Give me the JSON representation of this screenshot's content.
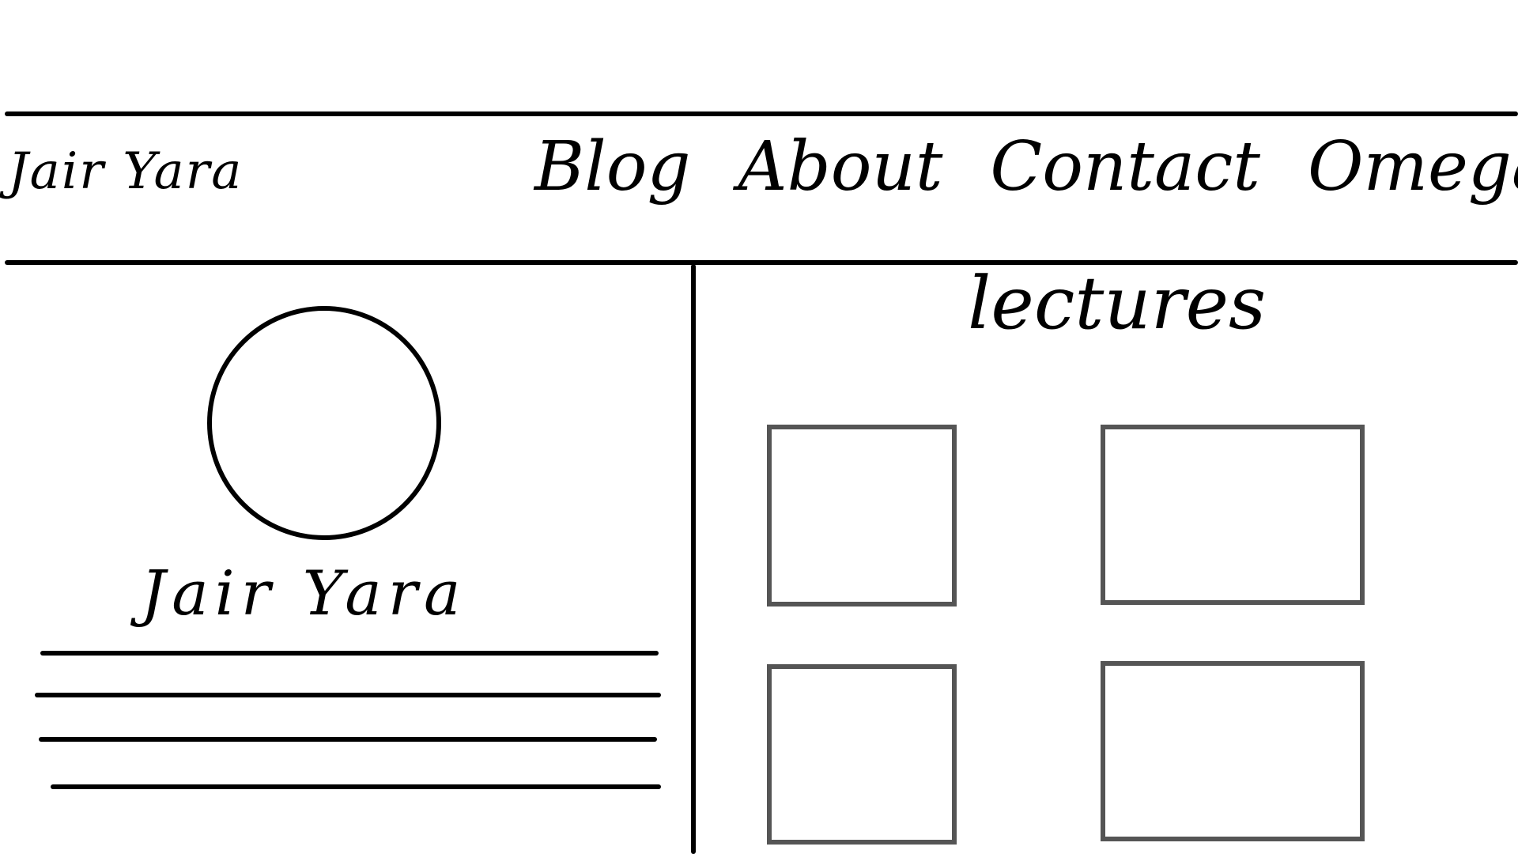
{
  "header": {
    "brand": "Jair Yara",
    "nav": [
      {
        "label": "Blog"
      },
      {
        "label": "About"
      },
      {
        "label": "Contact"
      },
      {
        "label": "Omega"
      }
    ]
  },
  "profile": {
    "name": "Jair Yara",
    "bio_lines_count": 4
  },
  "main": {
    "section_title": "lectures",
    "cards_count": 4
  }
}
